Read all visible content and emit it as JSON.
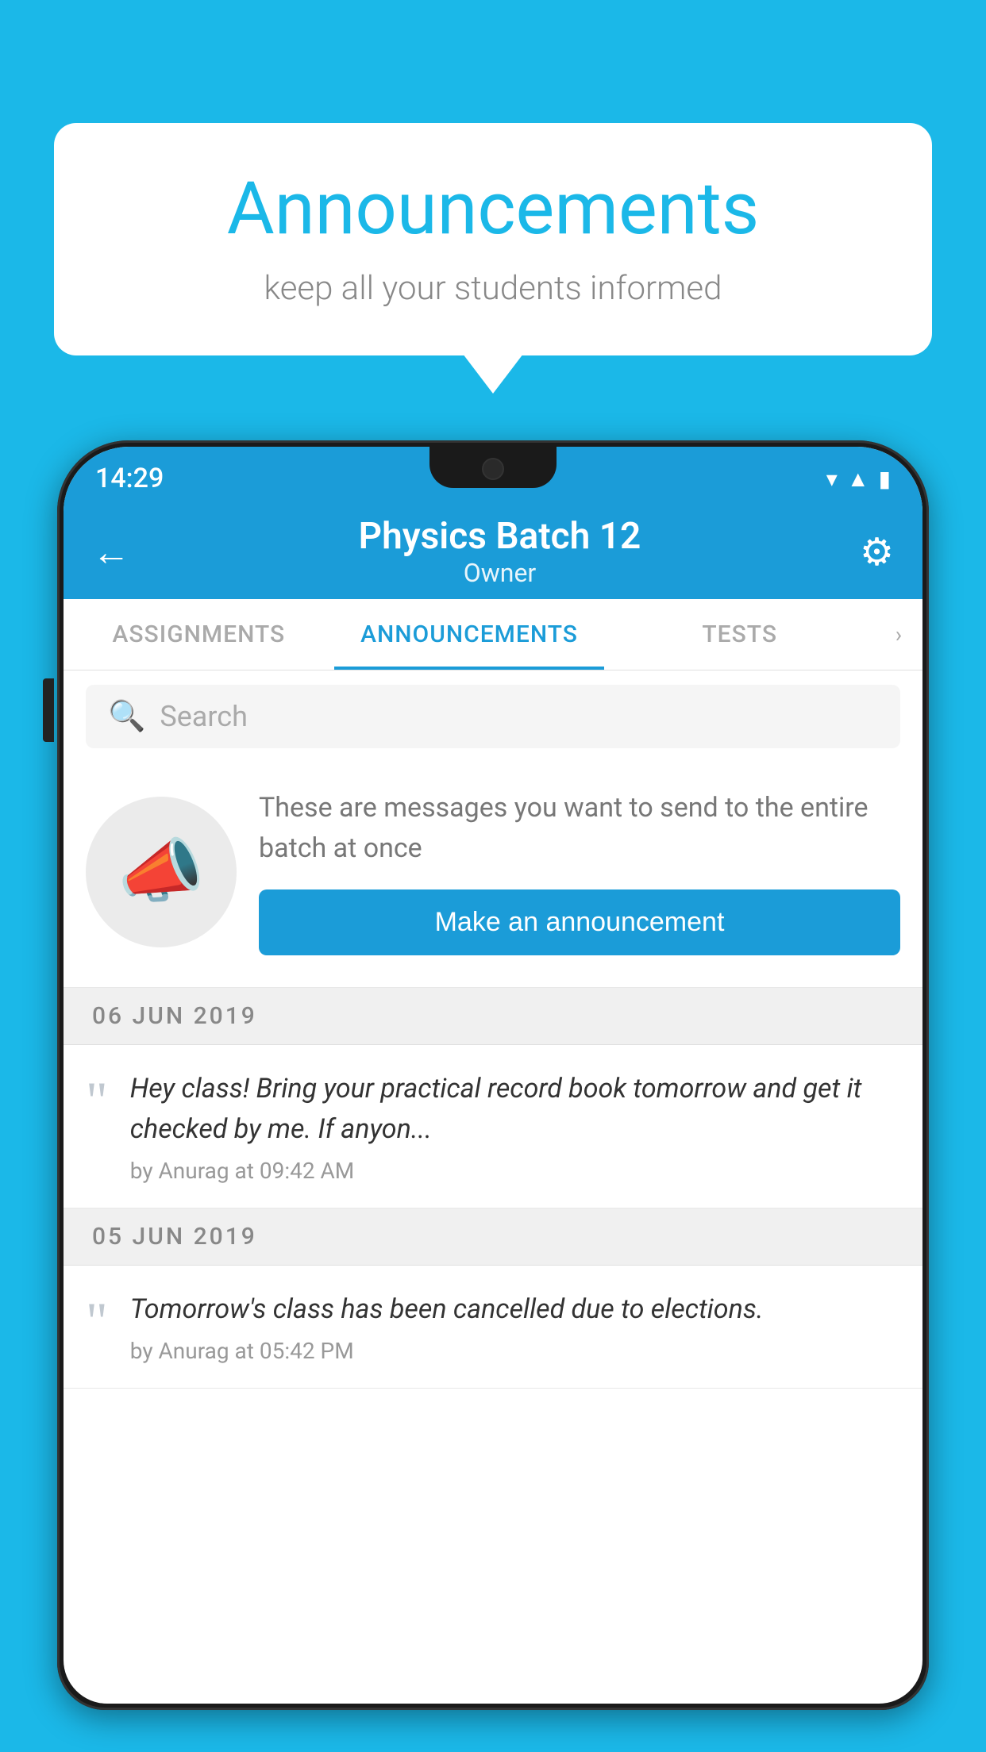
{
  "bubble": {
    "title": "Announcements",
    "subtitle": "keep all your students informed"
  },
  "phone": {
    "statusBar": {
      "time": "14:29"
    },
    "topBar": {
      "title": "Physics Batch 12",
      "subtitle": "Owner",
      "backIcon": "←",
      "gearIcon": "⚙"
    },
    "tabs": [
      {
        "label": "ASSIGNMENTS",
        "active": false
      },
      {
        "label": "ANNOUNCEMENTS",
        "active": true
      },
      {
        "label": "TESTS",
        "active": false
      }
    ],
    "search": {
      "placeholder": "Search"
    },
    "prompt": {
      "text": "These are messages you want to send to the entire batch at once",
      "buttonLabel": "Make an announcement"
    },
    "announcements": [
      {
        "date": "06  JUN  2019",
        "text": "Hey class! Bring your practical record book tomorrow and get it checked by me. If anyon...",
        "meta": "by Anurag at 09:42 AM"
      },
      {
        "date": "05  JUN  2019",
        "text": "Tomorrow's class has been cancelled due to elections.",
        "meta": "by Anurag at 05:42 PM"
      }
    ]
  },
  "colors": {
    "primary": "#1B9CD8",
    "background": "#1BB8E8",
    "white": "#ffffff"
  }
}
